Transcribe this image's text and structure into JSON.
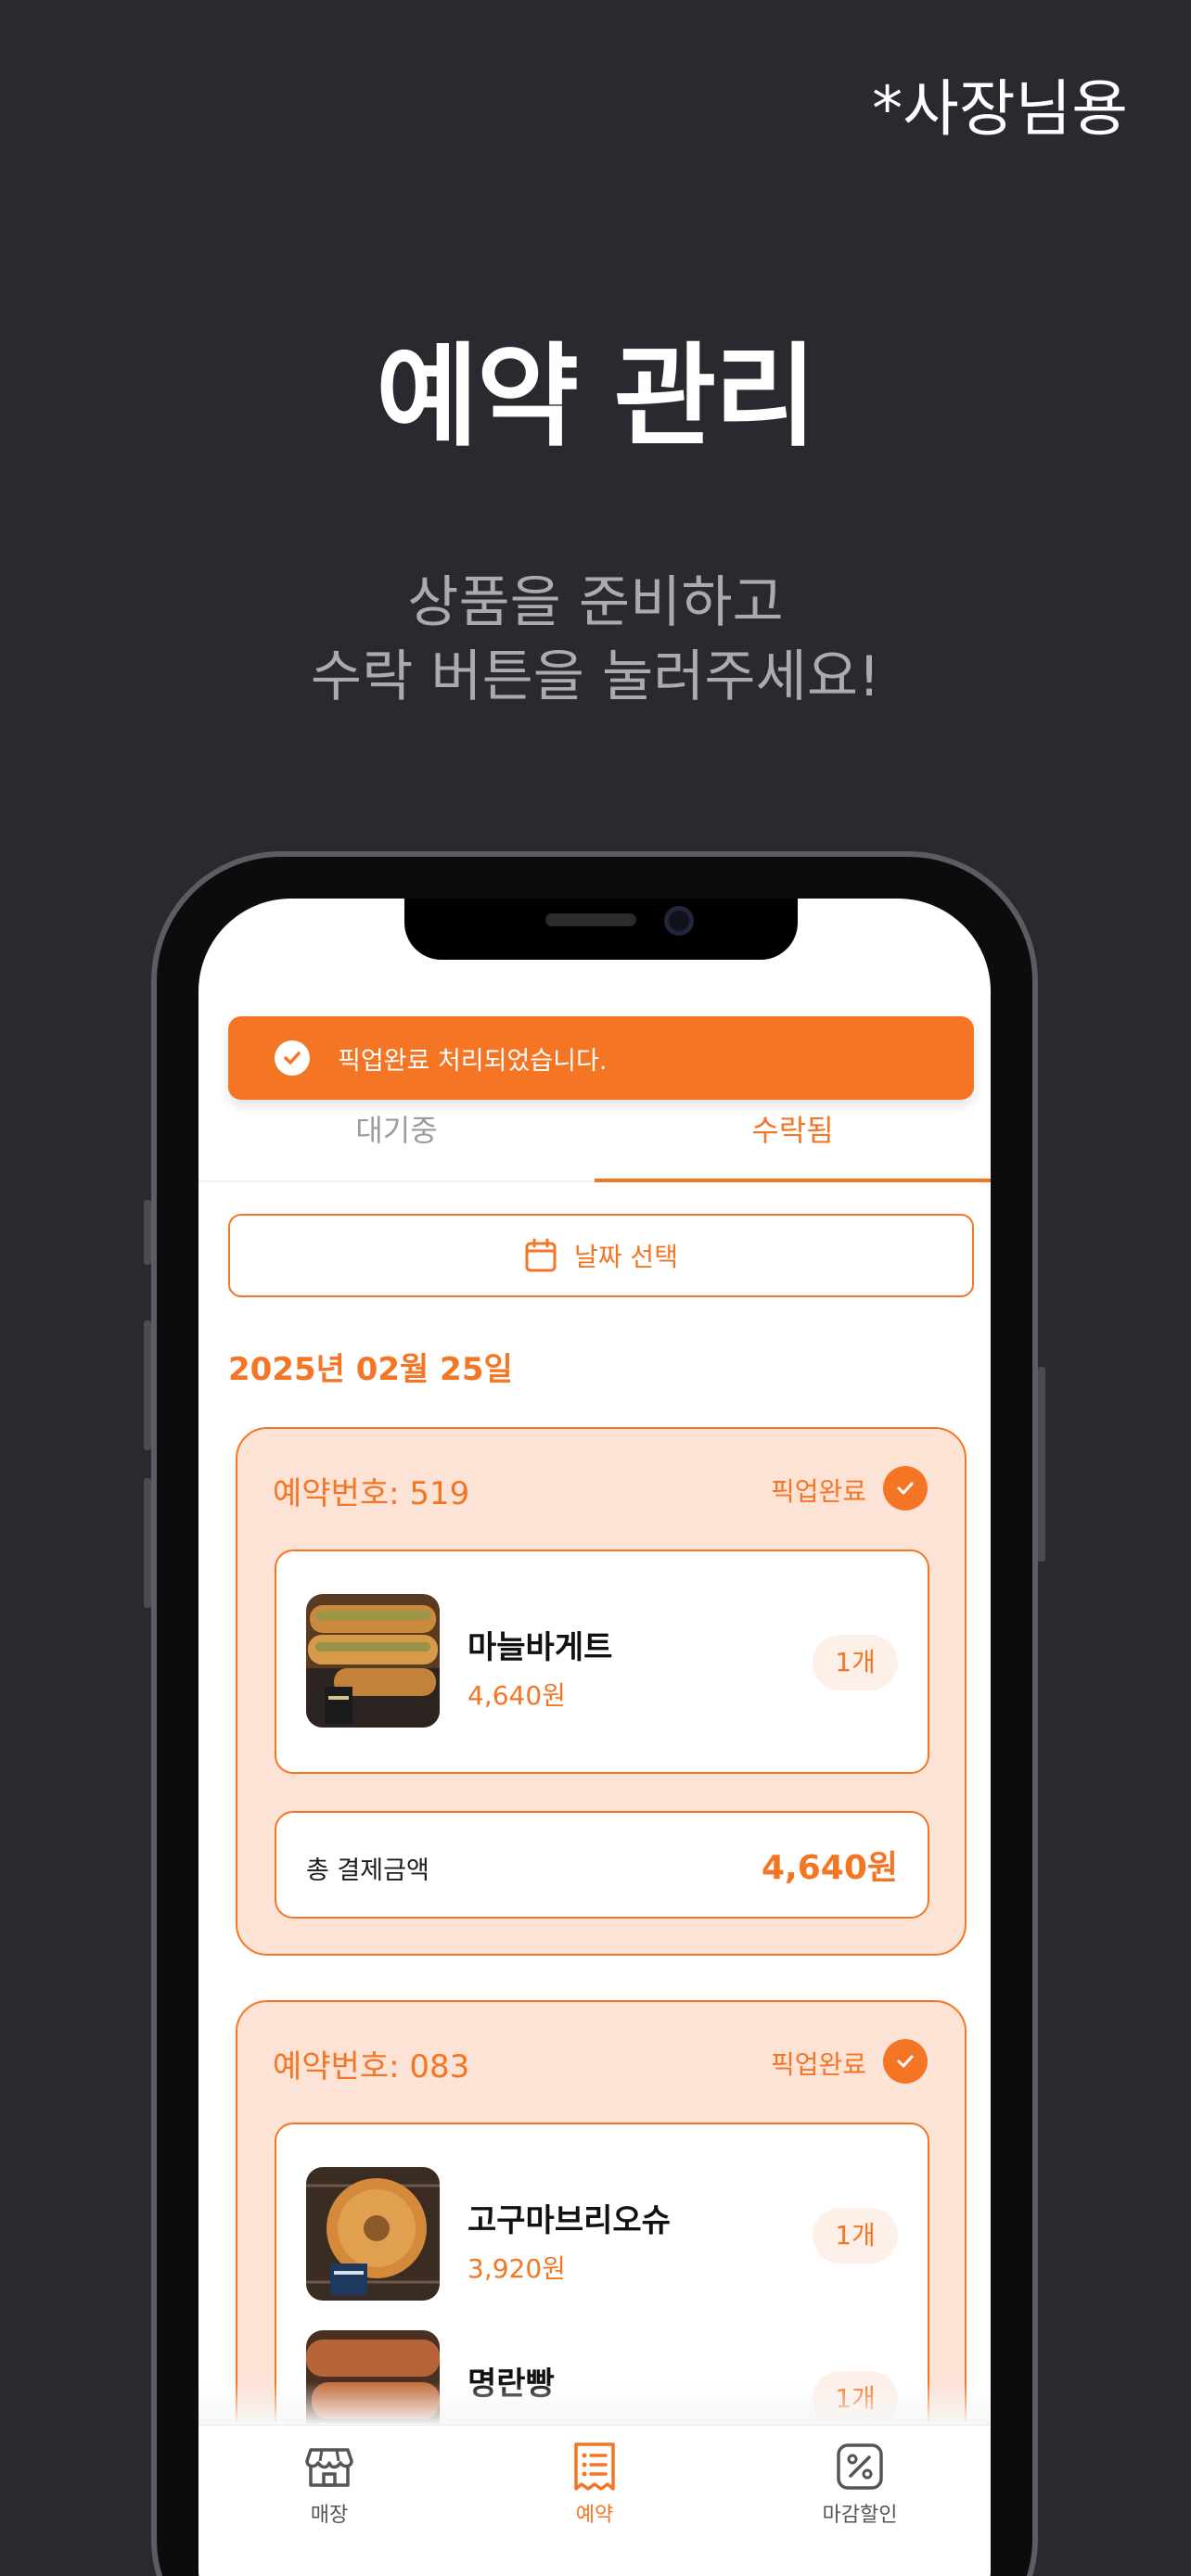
{
  "header": {
    "owner_tag": "*사장님용",
    "title": "예약 관리",
    "subtitle_line1": "상품을 준비하고",
    "subtitle_line2": "수락 버튼을 눌러주세요!"
  },
  "toast": {
    "message": "픽업완료 처리되었습니다."
  },
  "tabs": [
    {
      "label": "대기중",
      "active": false
    },
    {
      "label": "수락됨",
      "active": true
    }
  ],
  "date_picker": {
    "label": "날짜 선택"
  },
  "date_heading": "2025년 02월 25일",
  "orders": [
    {
      "number_label": "예약번호: 519",
      "status": "픽업완료",
      "items": [
        {
          "name": "마늘바게트",
          "price": "4,640원",
          "qty": "1개",
          "image": "garlic-baguette-photo"
        }
      ],
      "total_label": "총 결제금액",
      "total_value": "4,640원"
    },
    {
      "number_label": "예약번호: 083",
      "status": "픽업완료",
      "items": [
        {
          "name": "고구마브리오슈",
          "price": "3,920원",
          "qty": "1개",
          "image": "sweet-potato-brioche-photo"
        },
        {
          "name": "명란빵",
          "price": "",
          "qty": "1개",
          "image": "pollock-roe-bread-photo"
        }
      ]
    }
  ],
  "bottom_nav": [
    {
      "label": "매장",
      "icon": "store-icon",
      "active": false
    },
    {
      "label": "예약",
      "icon": "receipt-icon",
      "active": true
    },
    {
      "label": "마감할인",
      "icon": "discount-icon",
      "active": false
    }
  ],
  "colors": {
    "accent": "#f47625",
    "accent_light": "#fde3d6",
    "background": "#282a2f"
  }
}
